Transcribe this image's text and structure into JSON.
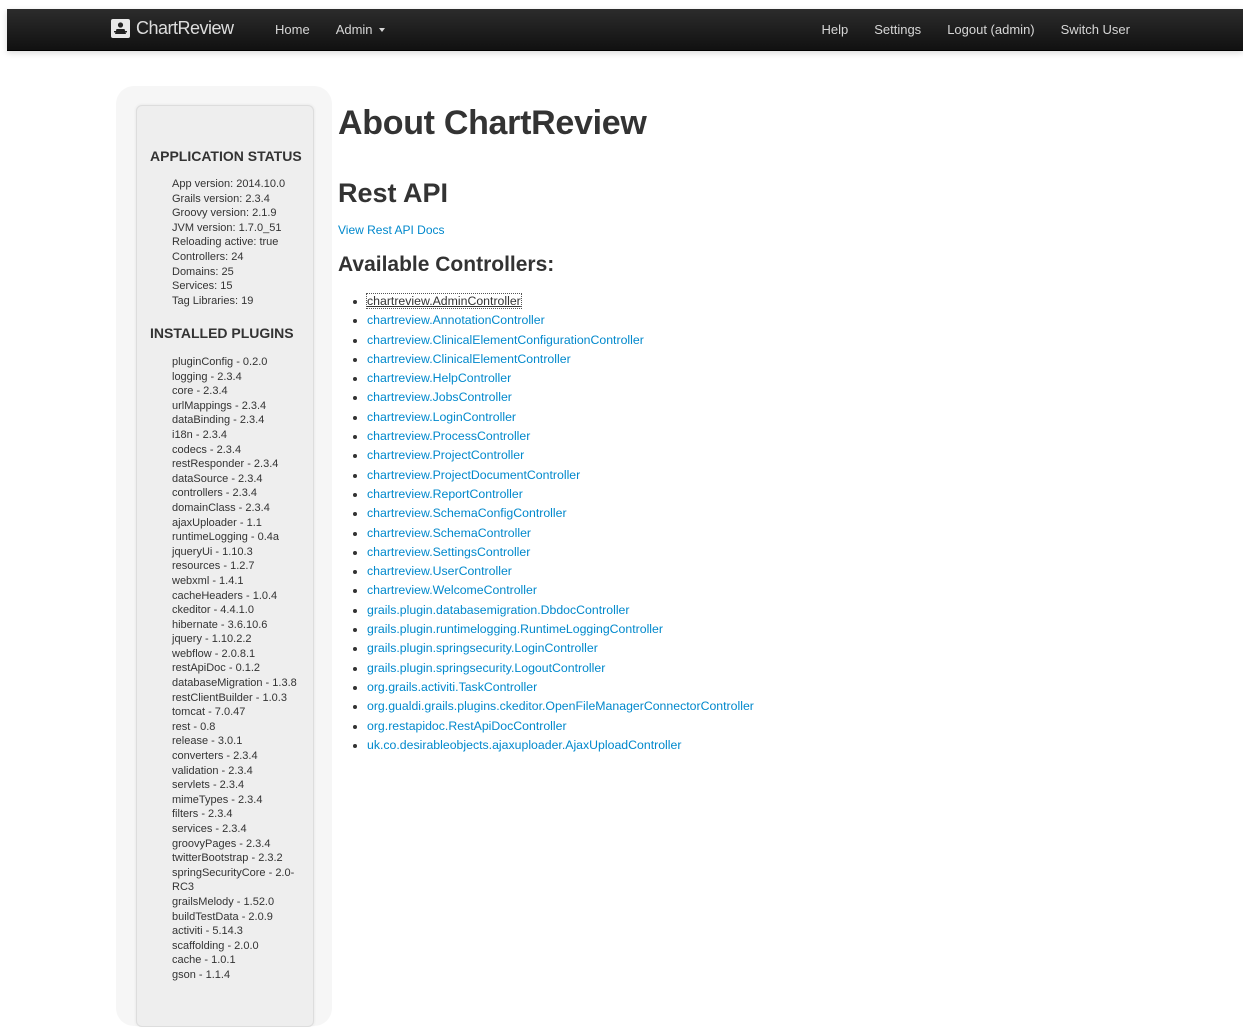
{
  "navbar": {
    "brand": "ChartReview",
    "left_links": [
      "Home",
      "Admin"
    ],
    "right_links": [
      "Help",
      "Settings",
      "Logout (admin)",
      "Switch User"
    ]
  },
  "sidebar": {
    "status_title": "Application Status",
    "status_items": [
      "App version: 2014.10.0",
      "Grails version: 2.3.4",
      "Groovy version: 2.1.9",
      "JVM version: 1.7.0_51",
      "Reloading active: true",
      "Controllers: 24",
      "Domains: 25",
      "Services: 15",
      "Tag Libraries: 19"
    ],
    "plugins_title": "Installed Plugins",
    "plugins": [
      "pluginConfig - 0.2.0",
      "logging - 2.3.4",
      "core - 2.3.4",
      "urlMappings - 2.3.4",
      "dataBinding - 2.3.4",
      "i18n - 2.3.4",
      "codecs - 2.3.4",
      "restResponder - 2.3.4",
      "dataSource - 2.3.4",
      "controllers - 2.3.4",
      "domainClass - 2.3.4",
      "ajaxUploader - 1.1",
      "runtimeLogging - 0.4a",
      "jqueryUi - 1.10.3",
      "resources - 1.2.7",
      "webxml - 1.4.1",
      "cacheHeaders - 1.0.4",
      "ckeditor - 4.4.1.0",
      "hibernate - 3.6.10.6",
      "jquery - 1.10.2.2",
      "webflow - 2.0.8.1",
      "restApiDoc - 0.1.2",
      "databaseMigration - 1.3.8",
      "restClientBuilder - 1.0.3",
      "tomcat - 7.0.47",
      "rest - 0.8",
      "release - 3.0.1",
      "converters - 2.3.4",
      "validation - 2.3.4",
      "servlets - 2.3.4",
      "mimeTypes - 2.3.4",
      "filters - 2.3.4",
      "services - 2.3.4",
      "groovyPages - 2.3.4",
      "twitterBootstrap - 2.3.2",
      "springSecurityCore - 2.0-RC3",
      "grailsMelody - 1.52.0",
      "buildTestData - 2.0.9",
      "activiti - 5.14.3",
      "scaffolding - 2.0.0",
      "cache - 1.0.1",
      "gson - 1.1.4"
    ]
  },
  "main": {
    "title": "About ChartReview",
    "rest_heading": "Rest API",
    "rest_docs_link": "View Rest API Docs",
    "controllers_heading": "Available Controllers:",
    "controllers": [
      "chartreview.AdminController",
      "chartreview.AnnotationController",
      "chartreview.ClinicalElementConfigurationController",
      "chartreview.ClinicalElementController",
      "chartreview.HelpController",
      "chartreview.JobsController",
      "chartreview.LoginController",
      "chartreview.ProcessController",
      "chartreview.ProjectController",
      "chartreview.ProjectDocumentController",
      "chartreview.ReportController",
      "chartreview.SchemaConfigController",
      "chartreview.SchemaController",
      "chartreview.SettingsController",
      "chartreview.UserController",
      "chartreview.WelcomeController",
      "grails.plugin.databasemigration.DbdocController",
      "grails.plugin.runtimelogging.RuntimeLoggingController",
      "grails.plugin.springsecurity.LoginController",
      "grails.plugin.springsecurity.LogoutController",
      "org.grails.activiti.TaskController",
      "org.gualdi.grails.plugins.ckeditor.OpenFileManagerConnectorController",
      "org.restapidoc.RestApiDocController",
      "uk.co.desirableobjects.ajaxuploader.AjaxUploadController"
    ]
  },
  "colors": {
    "link": "#0088cc",
    "navbar": "#1b1b1b",
    "sidebar": "#eeeeee"
  }
}
